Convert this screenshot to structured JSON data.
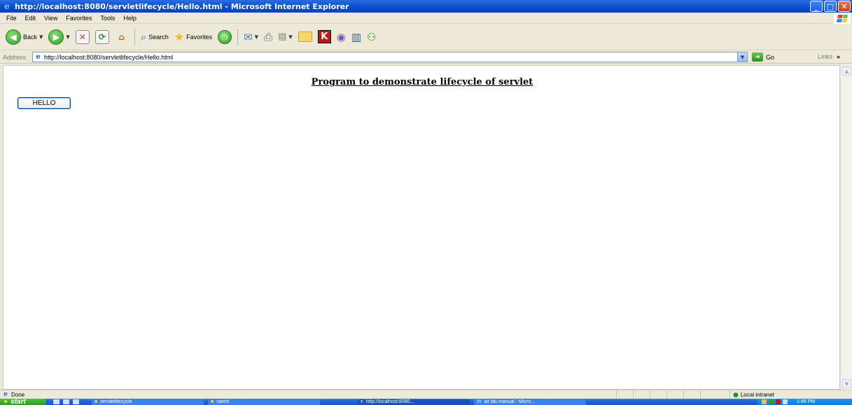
{
  "window": {
    "title": "http://localhost:8080/servletlifecycle/Hello.html - Microsoft Internet Explorer",
    "controls": {
      "minimize": "_",
      "maximize": "□",
      "close": "✕"
    }
  },
  "menu": [
    "File",
    "Edit",
    "View",
    "Favorites",
    "Tools",
    "Help"
  ],
  "toolbar": {
    "back_label": "Back",
    "search_label": "Search",
    "favorites_label": "Favorites"
  },
  "address": {
    "label": "Address",
    "url": "http://localhost:8080/servletlifecycle/Hello.html",
    "go_label": "Go",
    "links_label": "Links",
    "links_more": "»"
  },
  "page": {
    "heading": "Program to demonstrate lifecycle of servlet",
    "button_label": "HELLO"
  },
  "status": {
    "text": "Done",
    "zone": "Local intranet"
  },
  "taskbar": {
    "start_label": "start",
    "tasks": [
      {
        "label": "servletlifecycle",
        "icon": "folder-icon"
      },
      {
        "label": "satish",
        "icon": "folder-icon"
      },
      {
        "label": "http://localhost:8080...",
        "icon": "ie-icon"
      },
      {
        "label": "wt lab manual - Micro...",
        "icon": "word-icon"
      }
    ],
    "clock": "1:46 PM"
  }
}
